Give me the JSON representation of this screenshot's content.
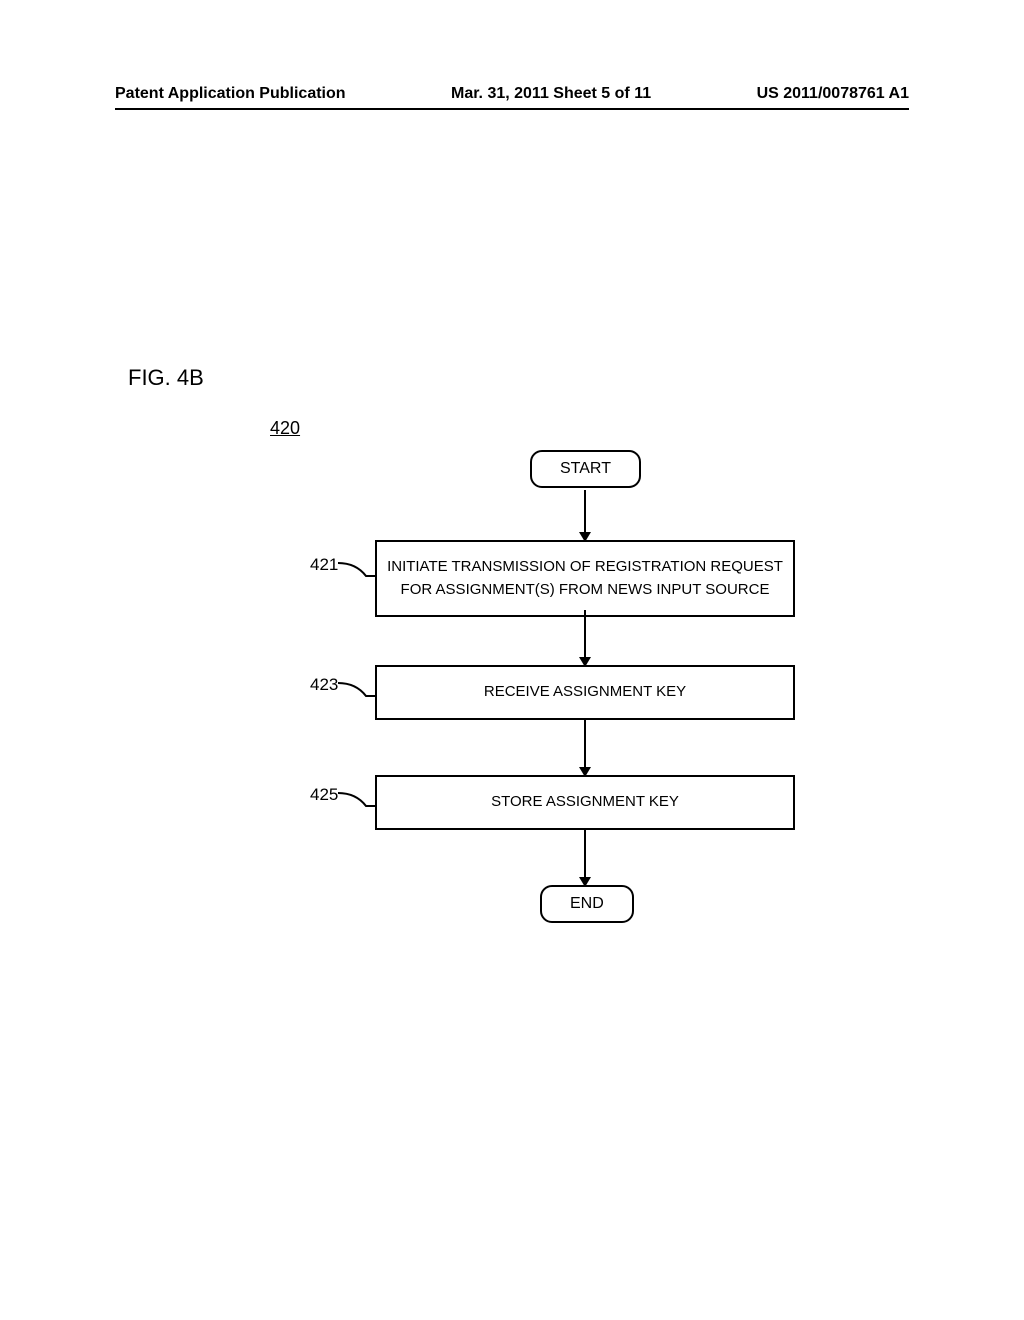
{
  "header": {
    "left": "Patent Application Publication",
    "center": "Mar. 31, 2011  Sheet 5 of 11",
    "right": "US 2011/0078761 A1"
  },
  "figure": {
    "label": "FIG. 4B",
    "ref": "420"
  },
  "chart_data": {
    "type": "flowchart",
    "title": "FIG. 4B",
    "reference_number": "420",
    "nodes": [
      {
        "id": "start",
        "type": "terminal",
        "text": "START"
      },
      {
        "id": "421",
        "type": "process",
        "ref": "421",
        "text": "INITIATE TRANSMISSION OF REGISTRATION REQUEST FOR ASSIGNMENT(S) FROM NEWS INPUT SOURCE"
      },
      {
        "id": "423",
        "type": "process",
        "ref": "423",
        "text": "RECEIVE ASSIGNMENT KEY"
      },
      {
        "id": "425",
        "type": "process",
        "ref": "425",
        "text": "STORE ASSIGNMENT KEY"
      },
      {
        "id": "end",
        "type": "terminal",
        "text": "END"
      }
    ],
    "edges": [
      {
        "from": "start",
        "to": "421"
      },
      {
        "from": "421",
        "to": "423"
      },
      {
        "from": "423",
        "to": "425"
      },
      {
        "from": "425",
        "to": "end"
      }
    ]
  },
  "flow": {
    "start": "START",
    "end": "END",
    "step421_ref": "421",
    "step421_line1": "INITIATE TRANSMISSION OF REGISTRATION REQUEST",
    "step421_line2": "FOR ASSIGNMENT(S) FROM NEWS INPUT SOURCE",
    "step423_ref": "423",
    "step423_text": "RECEIVE ASSIGNMENT KEY",
    "step425_ref": "425",
    "step425_text": "STORE ASSIGNMENT KEY"
  }
}
